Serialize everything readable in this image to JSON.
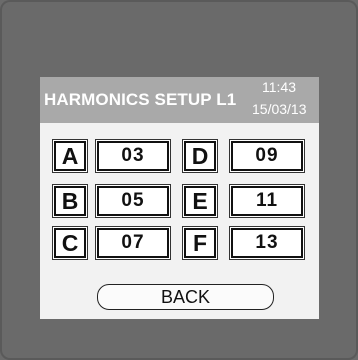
{
  "header": {
    "title": "HARMONICS SETUP L1",
    "time": "11:43",
    "date": "15/03/13"
  },
  "grid": {
    "left": [
      {
        "letter": "A",
        "value": "03"
      },
      {
        "letter": "B",
        "value": "05"
      },
      {
        "letter": "C",
        "value": "07"
      }
    ],
    "right": [
      {
        "letter": "D",
        "value": "09"
      },
      {
        "letter": "E",
        "value": "11"
      },
      {
        "letter": "F",
        "value": "13"
      }
    ]
  },
  "footer": {
    "back_label": "BACK"
  }
}
